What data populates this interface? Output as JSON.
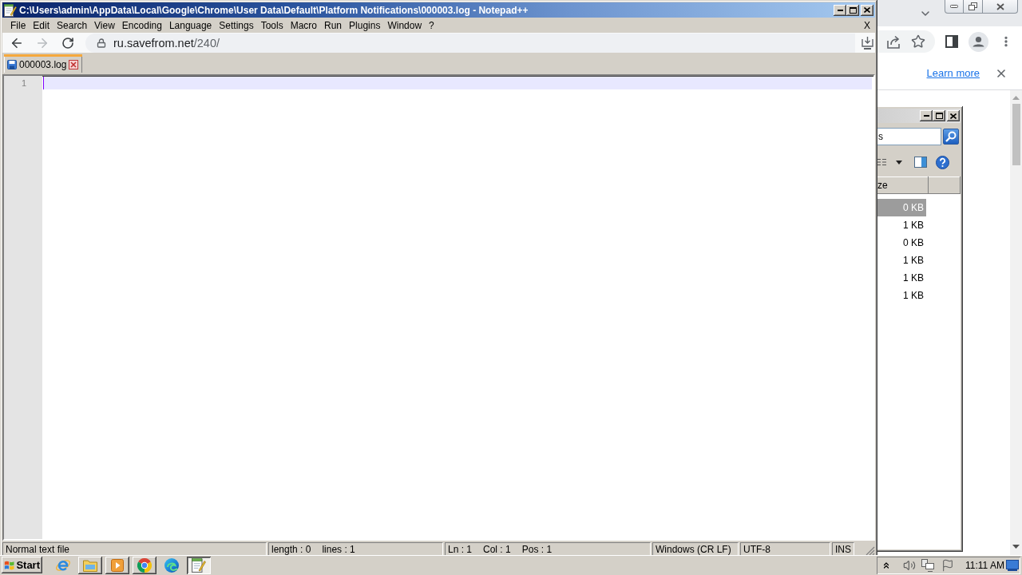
{
  "notepad": {
    "title": "C:\\Users\\admin\\AppData\\Local\\Google\\Chrome\\User Data\\Default\\Platform Notifications\\000003.log - Notepad++",
    "menu": [
      "File",
      "Edit",
      "Search",
      "View",
      "Encoding",
      "Language",
      "Settings",
      "Tools",
      "Macro",
      "Run",
      "Plugins",
      "Window",
      "?"
    ],
    "close_document": "X",
    "address_bar": {
      "host": "ru.savefrom.net",
      "path": "/240/",
      "forward_disabled": true
    },
    "tabs": [
      {
        "label": "000003.log",
        "selected": true
      }
    ],
    "editor": {
      "lines": [
        {
          "number": "1",
          "current": true
        }
      ]
    },
    "status_bar": {
      "file_type": "Normal text file",
      "length": "length : 0",
      "lines": "lines : 1",
      "line": "Ln : 1",
      "column": "Col : 1",
      "position": "Pos : 1",
      "eol": "Windows (CR LF)",
      "encoding": "UTF-8",
      "mode": "INS"
    }
  },
  "browser": {
    "infobar": {
      "link": "Learn more"
    }
  },
  "explorer": {
    "search": {
      "value": "s"
    },
    "columns": [
      "ze"
    ],
    "rows": [
      {
        "size": "0 KB",
        "selected": true
      },
      {
        "size": "1 KB",
        "selected": false
      },
      {
        "size": "0 KB",
        "selected": false
      },
      {
        "size": "1 KB",
        "selected": false
      },
      {
        "size": "1 KB",
        "selected": false
      },
      {
        "size": "1 KB",
        "selected": false
      }
    ]
  },
  "taskbar": {
    "start": "Start",
    "apps": [
      {
        "kind": "ie",
        "running": false,
        "selected": false
      },
      {
        "kind": "folder",
        "running": true,
        "selected": false
      },
      {
        "kind": "media",
        "running": true,
        "selected": false
      },
      {
        "kind": "chrome",
        "running": true,
        "selected": false
      },
      {
        "kind": "edge",
        "running": false,
        "selected": false
      },
      {
        "kind": "notepad",
        "running": true,
        "selected": true
      }
    ],
    "clock": "11:11 AM"
  }
}
